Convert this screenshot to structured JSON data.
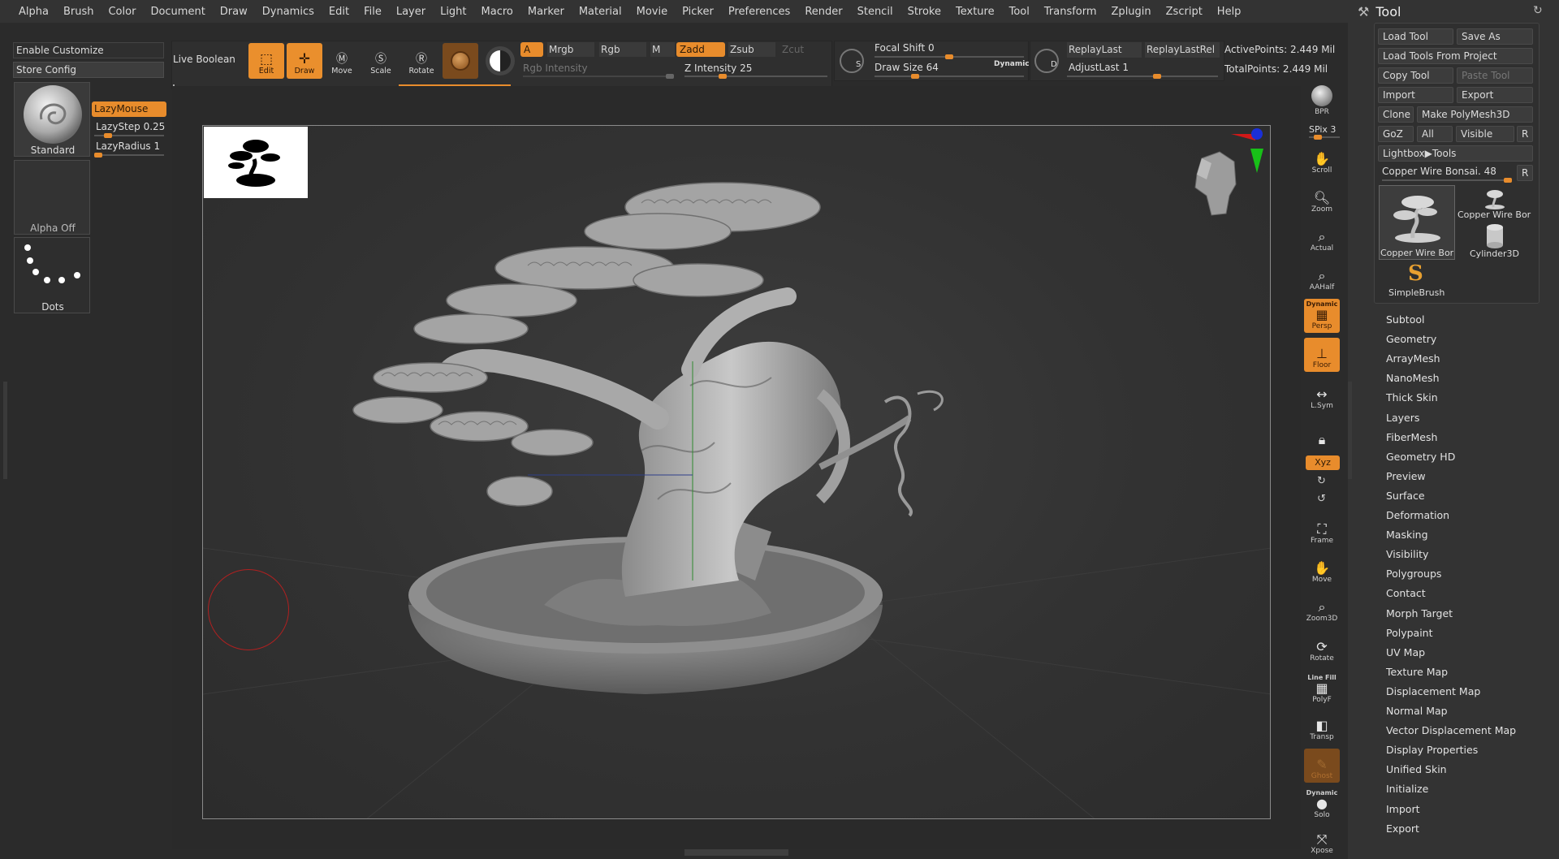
{
  "menu": [
    "Alpha",
    "Brush",
    "Color",
    "Document",
    "Draw",
    "Dynamics",
    "Edit",
    "File",
    "Layer",
    "Light",
    "Macro",
    "Marker",
    "Material",
    "Movie",
    "Picker",
    "Preferences",
    "Render",
    "Stencil",
    "Stroke",
    "Texture",
    "Tool",
    "Transform",
    "Zplugin",
    "Zscript",
    "Help"
  ],
  "left": {
    "enable_customize": "Enable Customize",
    "store_config": "Store Config",
    "brush_name": "Standard",
    "alpha_name": "Alpha Off",
    "stroke_name": "Dots",
    "lazymouse": "LazyMouse",
    "lazystep": "LazyStep 0.25",
    "lazyradius": "LazyRadius 1"
  },
  "shelf": {
    "live_boolean": "Live Boolean",
    "edit": "Edit",
    "draw": "Draw",
    "move": "Move",
    "scale": "Scale",
    "rotate": "Rotate",
    "a": "A",
    "mrgb": "Mrgb",
    "rgb": "Rgb",
    "m": "M",
    "zadd": "Zadd",
    "zsub": "Zsub",
    "zcut": "Zcut",
    "rgb_intensity": "Rgb Intensity",
    "z_intensity": "Z Intensity 25",
    "focal_shift": "Focal Shift 0",
    "draw_size": "Draw Size 64",
    "dynamic": "Dynamic",
    "replay_last": "ReplayLast",
    "replay_last_rel": "ReplayLastRel",
    "adjust_last": "AdjustLast 1",
    "active_points": "ActivePoints: 2.449 Mil",
    "total_points": "TotalPoints: 2.449 Mil",
    "z_intensity_level": 0.25,
    "draw_size_level": 0.26,
    "focal_shift_level": 0.5,
    "adjust_last_level": 0.6
  },
  "vshelf": {
    "bpr": "BPR",
    "spix": "SPix 3",
    "scroll": "Scroll",
    "zoom": "Zoom",
    "actual": "Actual",
    "aahalf": "AAHalf",
    "dynamic": "Dynamic",
    "persp": "Persp",
    "floor": "Floor",
    "lsym": "L.Sym",
    "xyz": "Xyz",
    "frame": "Frame",
    "move": "Move",
    "zoom3d": "Zoom3D",
    "rotate": "Rotate",
    "line_fill": "Line Fill",
    "polyf": "PolyF",
    "transp": "Transp",
    "ghost": "Ghost",
    "dynamic2": "Dynamic",
    "solo": "Solo",
    "xpose": "Xpose"
  },
  "tool": {
    "title": "Tool",
    "load_tool": "Load Tool",
    "save_as": "Save As",
    "load_from_project": "Load Tools From Project",
    "copy_tool": "Copy Tool",
    "paste_tool": "Paste Tool",
    "import": "Import",
    "export": "Export",
    "clone": "Clone",
    "make_polymesh": "Make PolyMesh3D",
    "goz": "GoZ",
    "all": "All",
    "visible": "Visible",
    "r": "R",
    "lightbox": "Lightbox▶Tools",
    "current_tool": "Copper Wire Bonsai. 48",
    "thumbs": [
      "Copper Wire Bor",
      "Copper Wire Bor",
      "Cylinder3D",
      "SimpleBrush"
    ],
    "sections": [
      "Subtool",
      "Geometry",
      "ArrayMesh",
      "NanoMesh",
      "Thick Skin",
      "Layers",
      "FiberMesh",
      "Geometry HD",
      "Preview",
      "Surface",
      "Deformation",
      "Masking",
      "Visibility",
      "Polygroups",
      "Contact",
      "Morph Target",
      "Polypaint",
      "UV Map",
      "Texture Map",
      "Displacement Map",
      "Normal Map",
      "Vector Displacement Map",
      "Display Properties",
      "Unified Skin",
      "Initialize",
      "Import",
      "Export"
    ]
  },
  "colors": {
    "accent": "#e88c2c",
    "panel": "#333333",
    "canvas": "#383838"
  }
}
